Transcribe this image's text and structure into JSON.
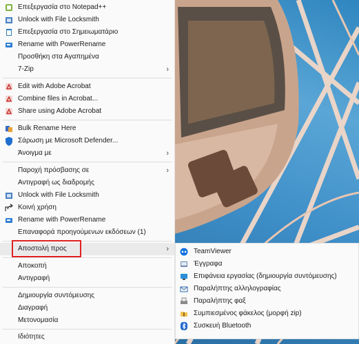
{
  "menu": {
    "items": [
      {
        "label": "Επεξεργασία στο Notepad++",
        "icon": "notepadpp-icon"
      },
      {
        "label": "Unlock with File Locksmith",
        "icon": "lock-icon"
      },
      {
        "label": "Επεξεργασία στο Σημειωματάριο",
        "icon": "notepad-icon"
      },
      {
        "label": "Rename with PowerRename",
        "icon": "powerrename-icon"
      },
      {
        "label": "Προσθήκη στα Αγαπημένα",
        "icon": ""
      },
      {
        "label": "7-Zip",
        "icon": "",
        "arrow": "›"
      },
      {
        "label": "Edit with Adobe Acrobat",
        "icon": "acrobat-icon"
      },
      {
        "label": "Combine files in Acrobat...",
        "icon": "acrobat-icon"
      },
      {
        "label": "Share using Adobe Acrobat",
        "icon": "acrobat-icon"
      },
      {
        "label": "Bulk Rename Here",
        "icon": "bulk-rename-icon"
      },
      {
        "label": "Σάρωση με Microsoft Defender...",
        "icon": "defender-shield-icon"
      },
      {
        "label": "Άνοιγμα με",
        "icon": "",
        "arrow": "›"
      },
      {
        "label": "Παροχή πρόσβασης σε",
        "icon": "",
        "arrow": "›"
      },
      {
        "label": "Αντιγραφή ως διαδρομής",
        "icon": ""
      },
      {
        "label": "Unlock with File Locksmith",
        "icon": "lock-icon"
      },
      {
        "label": "Κοινή χρήση",
        "icon": "share-icon"
      },
      {
        "label": "Rename with PowerRename",
        "icon": "powerrename-icon"
      },
      {
        "label": "Επαναφορά προηγούμενων εκδόσεων (1)",
        "icon": ""
      },
      {
        "label": "Αποστολή προς",
        "icon": "",
        "arrow": "›"
      },
      {
        "label": "Αποκοπή",
        "icon": ""
      },
      {
        "label": "Αντιγραφή",
        "icon": ""
      },
      {
        "label": "Δημιουργία συντόμευσης",
        "icon": ""
      },
      {
        "label": "Διαγραφή",
        "icon": ""
      },
      {
        "label": "Μετονομασία",
        "icon": ""
      },
      {
        "label": "Ιδιότητες",
        "icon": ""
      }
    ]
  },
  "submenu": {
    "items": [
      {
        "label": "TeamViewer",
        "icon": "teamviewer-icon"
      },
      {
        "label": "Έγγραφα",
        "icon": "documents-icon"
      },
      {
        "label": "Επιφάνεια εργασίας (δημιουργία συντόμευσης)",
        "icon": "desktop-icon"
      },
      {
        "label": "Παραλήπτης αλληλογραφίας",
        "icon": "mail-icon"
      },
      {
        "label": "Παραλήπτης φαξ",
        "icon": "fax-icon"
      },
      {
        "label": "Συμπιεσμένος φάκελος (μορφή zip)",
        "icon": "zip-folder-icon"
      },
      {
        "label": "Συσκευή Bluetooth",
        "icon": "bluetooth-icon"
      }
    ]
  },
  "colors": {
    "highlight_border": "#e02020",
    "acrobat": "#c8322f",
    "defender": "#1f6fd0",
    "teamviewer": "#0e6fdc"
  }
}
